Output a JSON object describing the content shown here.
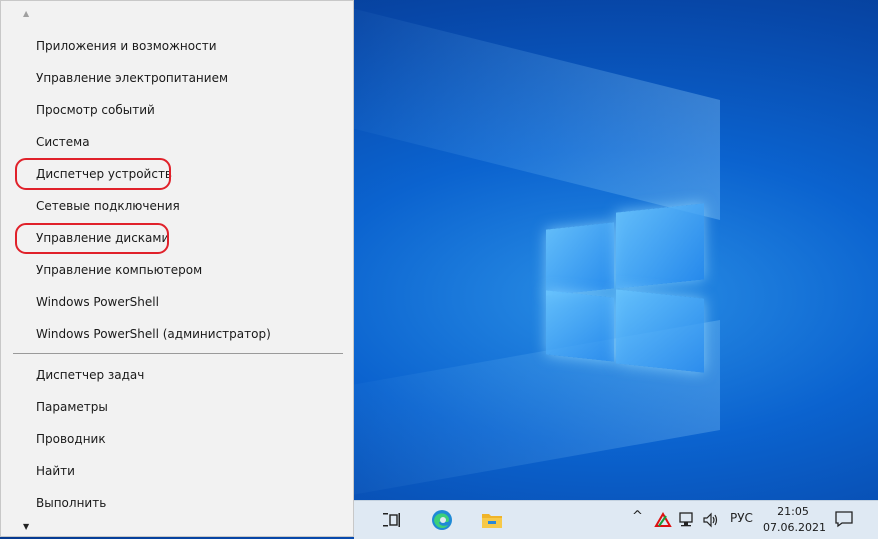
{
  "menu": {
    "items": [
      {
        "label": "Приложения и возможности"
      },
      {
        "label": "Управление электропитанием"
      },
      {
        "label": "Просмотр событий"
      },
      {
        "label": "Система"
      },
      {
        "label": "Диспетчер устройств"
      },
      {
        "label": "Сетевые подключения"
      },
      {
        "label": "Управление дисками"
      },
      {
        "label": "Управление компьютером"
      },
      {
        "label": "Windows PowerShell"
      },
      {
        "label": "Windows PowerShell (администратор)"
      },
      {
        "label": "Диспетчер задач"
      },
      {
        "label": "Параметры"
      },
      {
        "label": "Проводник"
      },
      {
        "label": "Найти"
      },
      {
        "label": "Выполнить"
      }
    ],
    "highlight_color": "#e0212a"
  },
  "taskbar": {
    "icons": [
      "task-view-icon",
      "edge-icon",
      "file-explorer-icon"
    ],
    "tray": {
      "chevron": "^",
      "language": "РУС",
      "icons": [
        "antivirus-icon",
        "network-icon",
        "volume-icon"
      ]
    },
    "clock": {
      "time": "21:05",
      "date": "07.06.2021"
    },
    "notification_icon": "action-center-icon"
  }
}
